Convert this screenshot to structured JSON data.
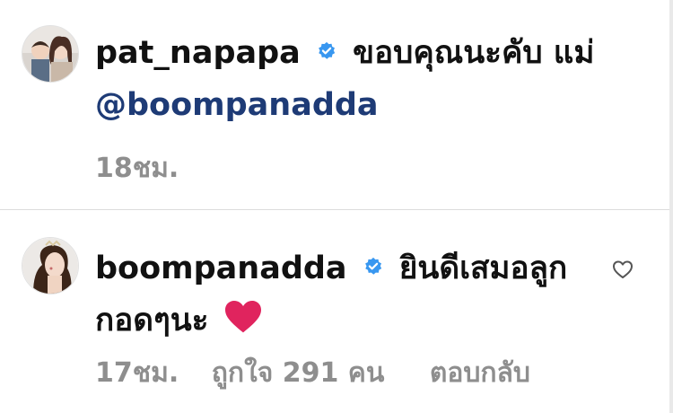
{
  "comments": [
    {
      "username": "pat_napapa",
      "text": "ขอบคุณนะคับ แม่",
      "mention": "@boompanadda",
      "time": "18ชม."
    },
    {
      "username": "boompanadda",
      "text": "ยินดีเสมอลูก กอดๆนะ",
      "time": "17ชม.",
      "likes": "ถูกใจ 291 คน",
      "reply": "ตอบกลับ"
    }
  ],
  "colors": {
    "verified": "#3897f0",
    "mention": "#1e3b76",
    "meta": "#8e8e8e",
    "heart": "#e0245e"
  },
  "icons": [
    "verified-badge-icon",
    "heart-outline-icon",
    "red-heart-emoji"
  ]
}
